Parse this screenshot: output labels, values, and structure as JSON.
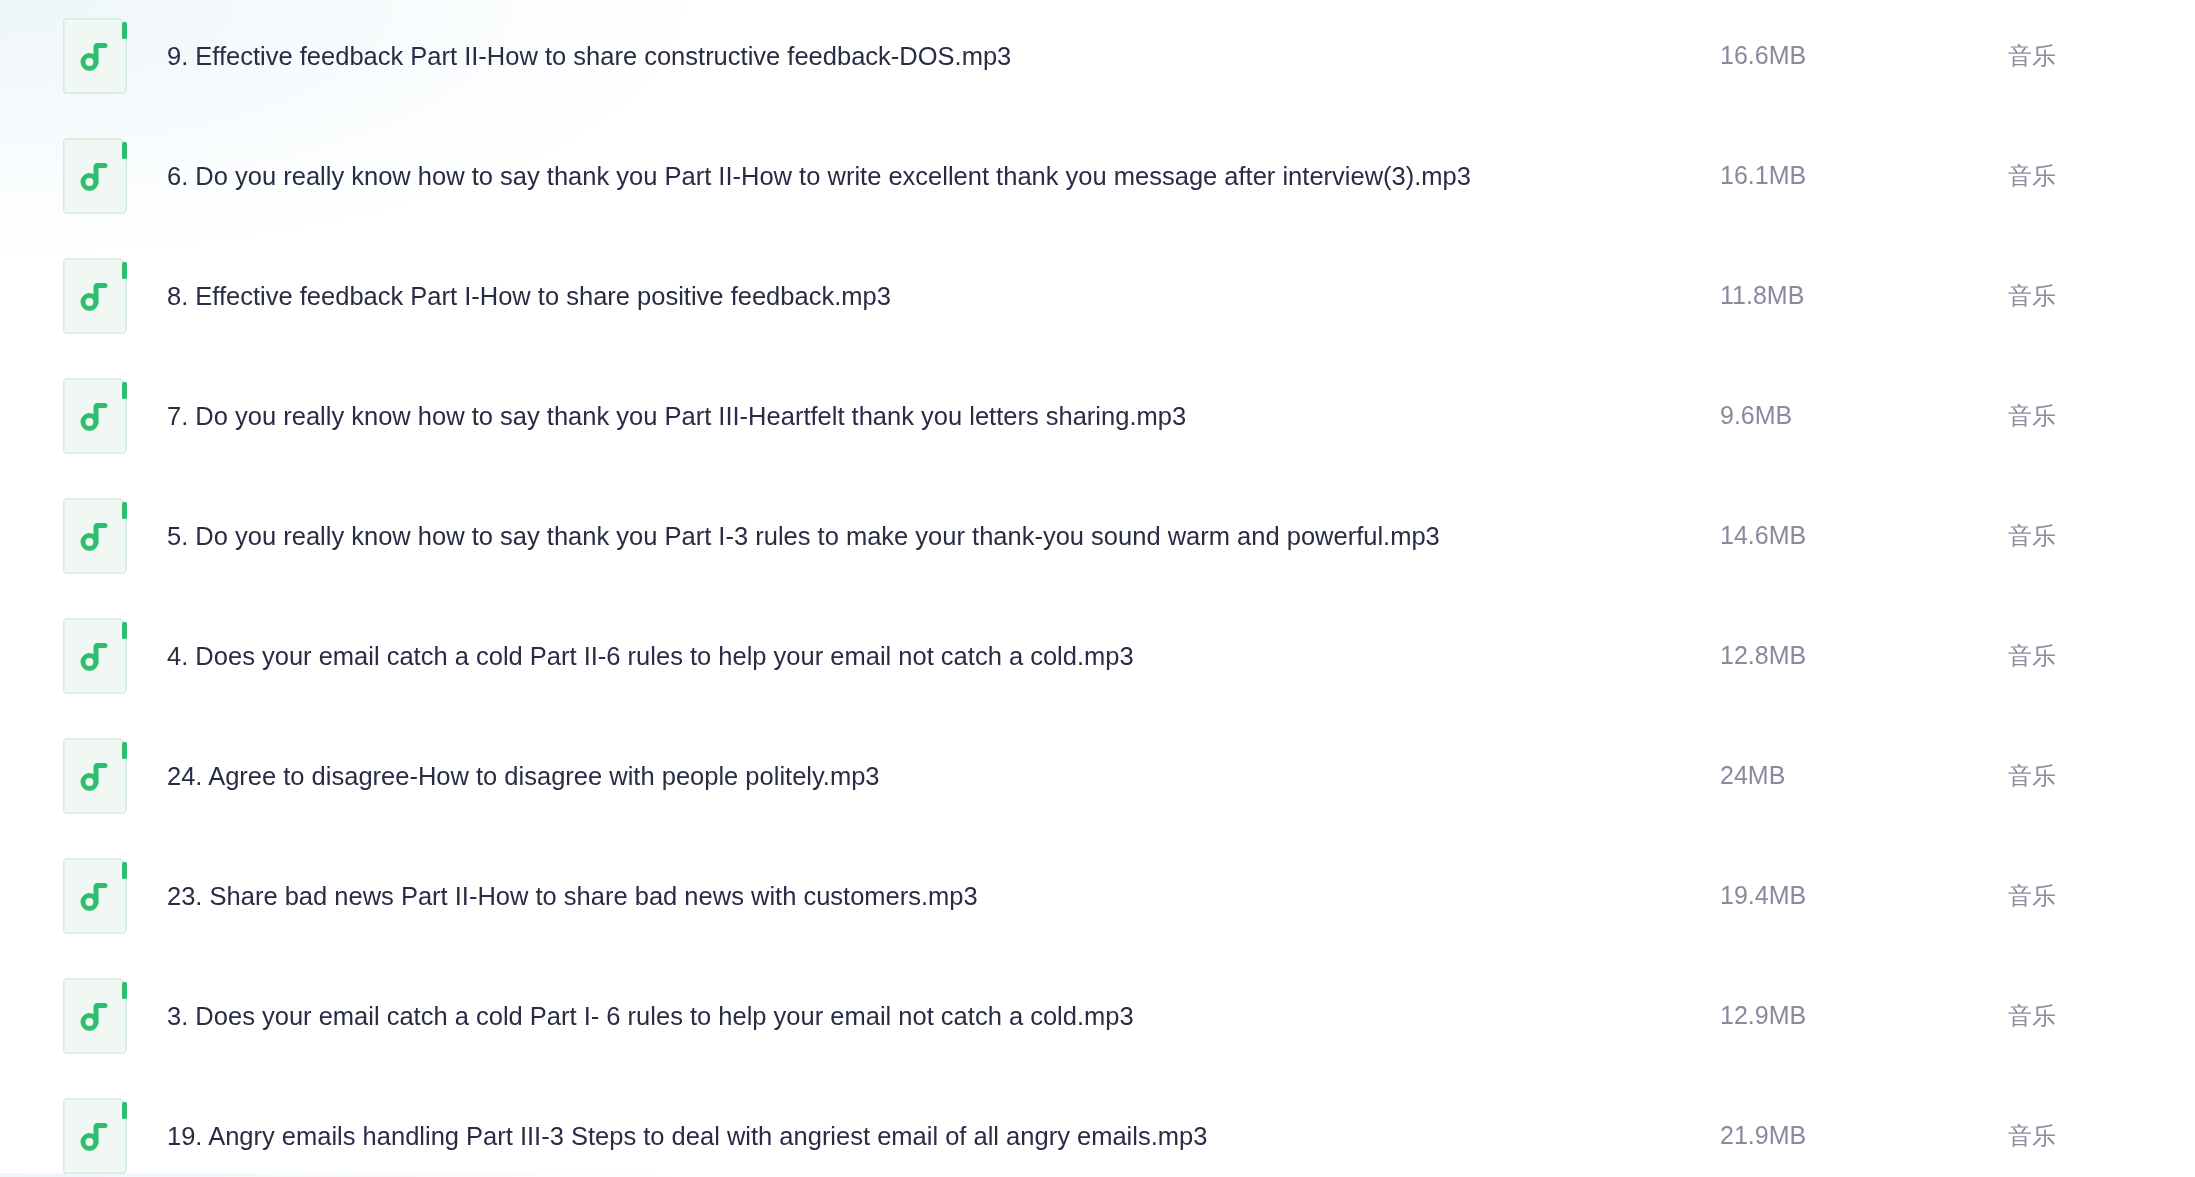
{
  "files": [
    {
      "name": "9. Effective feedback Part II-How to share constructive feedback-DOS.mp3",
      "size": "16.6MB",
      "type": "音乐"
    },
    {
      "name": "6. Do you really know how to say thank you Part II-How to write excellent thank you message after interview(3).mp3",
      "size": "16.1MB",
      "type": "音乐"
    },
    {
      "name": "8. Effective feedback Part I-How to share positive feedback.mp3",
      "size": "11.8MB",
      "type": "音乐"
    },
    {
      "name": "7. Do you really know how to say thank you Part III-Heartfelt thank you letters sharing.mp3",
      "size": "9.6MB",
      "type": "音乐"
    },
    {
      "name": "5. Do you really know how to say thank you Part I-3 rules to make your thank-you sound warm and powerful.mp3",
      "size": "14.6MB",
      "type": "音乐"
    },
    {
      "name": "4. Does your email catch a cold Part II-6 rules to help your email not catch a cold.mp3",
      "size": "12.8MB",
      "type": "音乐"
    },
    {
      "name": "24. Agree to disagree-How to disagree with people politely.mp3",
      "size": "24MB",
      "type": "音乐"
    },
    {
      "name": "23. Share bad news Part II-How to share bad news with customers.mp3",
      "size": "19.4MB",
      "type": "音乐"
    },
    {
      "name": "3. Does your email catch a cold Part I- 6 rules to help your email not catch a cold.mp3",
      "size": "12.9MB",
      "type": "音乐"
    },
    {
      "name": "19. Angry emails handling Part III-3 Steps to deal with angriest email of all angry emails.mp3",
      "size": "21.9MB",
      "type": "音乐"
    }
  ]
}
